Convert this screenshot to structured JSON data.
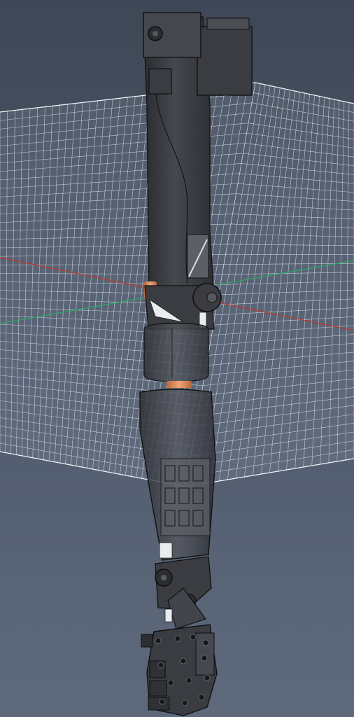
{
  "scene": {
    "kind": "3d-cad-viewport",
    "subject": "prosthetic-arm-assembly",
    "background_color_top": "#3e4755",
    "background_color_bottom": "#5e6a7c",
    "grid_color": "#e6ebf2",
    "axis_colors": {
      "x": "#c0392b",
      "y": "#27ae60"
    },
    "part_color": "#3b3d42",
    "part_edge_color": "#151618",
    "bearing_color": "#d98a5a",
    "bracket_color": "#e9ecef"
  }
}
